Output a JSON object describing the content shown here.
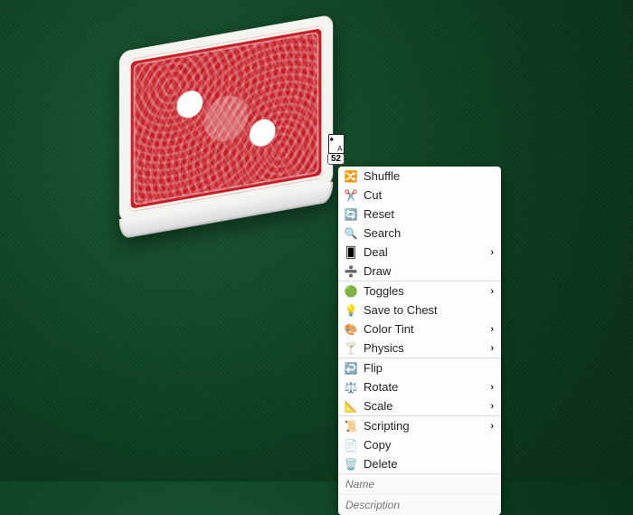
{
  "deck": {
    "count": "52"
  },
  "menu": {
    "sections": [
      [
        {
          "id": "shuffle",
          "label": "Shuffle",
          "icon": "shuffle",
          "submenu": false
        },
        {
          "id": "cut",
          "label": "Cut",
          "icon": "cut",
          "submenu": false
        },
        {
          "id": "reset",
          "label": "Reset",
          "icon": "reset",
          "submenu": false
        },
        {
          "id": "search",
          "label": "Search",
          "icon": "search",
          "submenu": false
        },
        {
          "id": "deal",
          "label": "Deal",
          "icon": "deal",
          "submenu": true
        },
        {
          "id": "draw",
          "label": "Draw",
          "icon": "draw",
          "submenu": false
        }
      ],
      [
        {
          "id": "toggles",
          "label": "Toggles",
          "icon": "toggles",
          "submenu": true
        },
        {
          "id": "save-to-chest",
          "label": "Save to Chest",
          "icon": "chest",
          "submenu": false
        },
        {
          "id": "color-tint",
          "label": "Color Tint",
          "icon": "tint",
          "submenu": true
        },
        {
          "id": "physics",
          "label": "Physics",
          "icon": "physics",
          "submenu": true
        }
      ],
      [
        {
          "id": "flip",
          "label": "Flip",
          "icon": "flip",
          "submenu": false
        },
        {
          "id": "rotate",
          "label": "Rotate",
          "icon": "rotate",
          "submenu": true
        },
        {
          "id": "scale",
          "label": "Scale",
          "icon": "scale",
          "submenu": true
        }
      ],
      [
        {
          "id": "scripting",
          "label": "Scripting",
          "icon": "scripting",
          "submenu": true
        },
        {
          "id": "copy",
          "label": "Copy",
          "icon": "copy",
          "submenu": false
        },
        {
          "id": "delete",
          "label": "Delete",
          "icon": "delete",
          "submenu": false
        }
      ]
    ],
    "inputs": {
      "name_placeholder": "Name",
      "desc_placeholder": "Description"
    }
  },
  "icons": {
    "shuffle": "🔀",
    "cut": "✂️",
    "reset": "🔄",
    "search": "🔍",
    "deal": "🂠",
    "draw": "➗",
    "toggles": "🟢",
    "chest": "💡",
    "tint": "🎨",
    "physics": "🍸",
    "flip": "↩️",
    "rotate": "⚖️",
    "scale": "📐",
    "scripting": "📜",
    "copy": "📄",
    "delete": "🗑️"
  }
}
